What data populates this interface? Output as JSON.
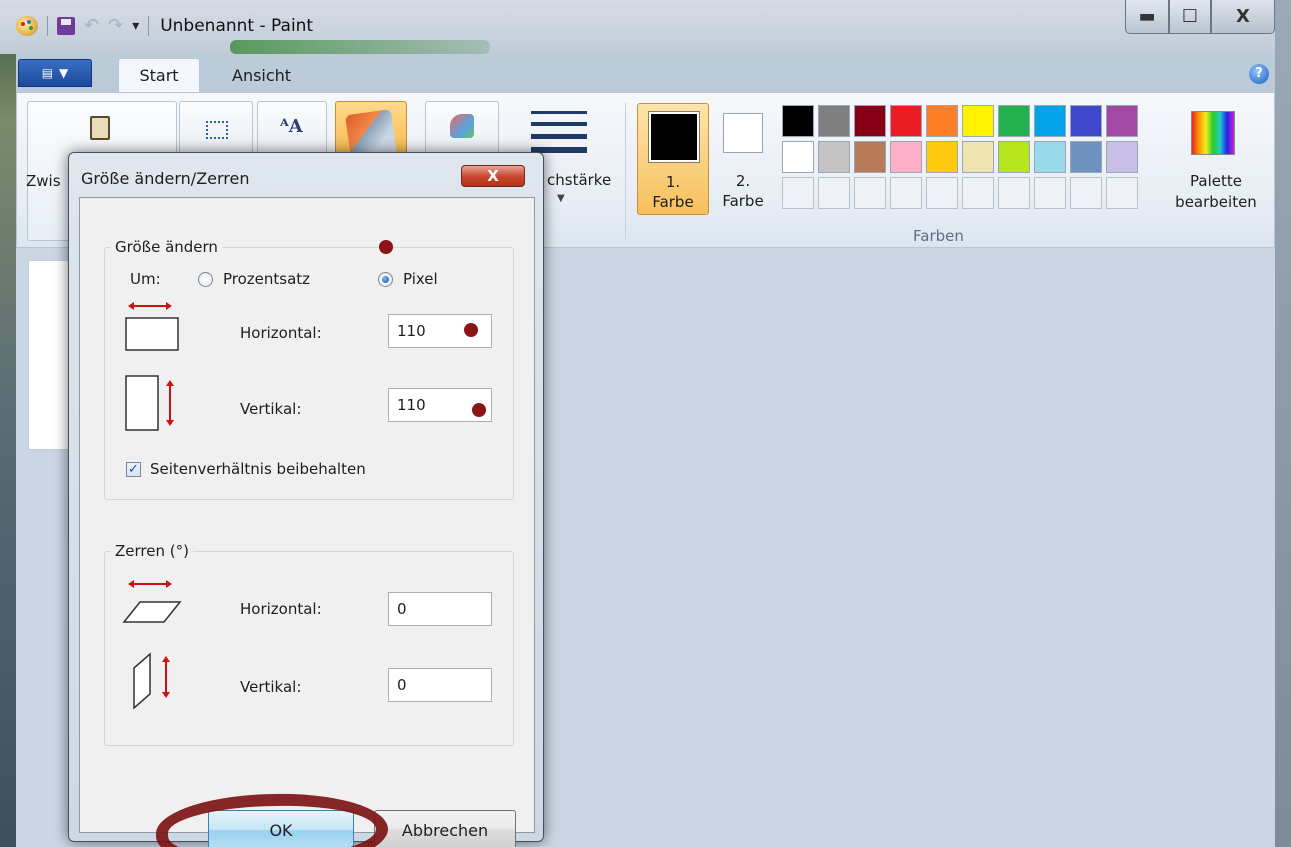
{
  "window": {
    "title": "Unbenannt - Paint",
    "controls": {
      "minimize": "▬",
      "maximize": "☐",
      "close": "X"
    }
  },
  "ribbon": {
    "tabs": [
      {
        "label": "Start"
      },
      {
        "label": "Ansicht"
      }
    ],
    "help": "?",
    "clipboard_label": "Zwis",
    "size_label": "chstärke",
    "color1_label_line1": "1.",
    "color1_label_line2": "Farbe",
    "color2_label_line1": "2.",
    "color2_label_line2": "Farbe",
    "edit_palette_line1": "Palette",
    "edit_palette_line2": "bearbeiten",
    "colors_group": "Farben",
    "palette_row1": [
      "#000000",
      "#7f7f7f",
      "#880015",
      "#ed1c24",
      "#ff7f27",
      "#fff200",
      "#22b14c",
      "#00a2e8",
      "#3f48cc",
      "#a349a4"
    ],
    "palette_row2": [
      "#ffffff",
      "#c3c3c3",
      "#b97a57",
      "#ffaec9",
      "#ffc90e",
      "#efe4b0",
      "#b5e61d",
      "#99d9ea",
      "#7092be",
      "#c8bfe7"
    ]
  },
  "dialog": {
    "title": "Größe ändern/Zerren",
    "close": "X",
    "resize": {
      "legend": "Größe ändern",
      "by_label": "Um:",
      "percent_label": "Prozentsatz",
      "pixel_label": "Pixel",
      "horizontal_label": "Horizontal:",
      "horizontal_value": "110",
      "vertical_label": "Vertikal:",
      "vertical_value": "110",
      "aspect_label": "Seitenverhältnis beibehalten",
      "aspect_check": "✓"
    },
    "skew": {
      "legend": "Zerren (°)",
      "horizontal_label": "Horizontal:",
      "horizontal_value": "0",
      "vertical_label": "Vertikal:",
      "vertical_value": "0"
    },
    "ok_label": "OK",
    "cancel_label": "Abbrechen"
  },
  "icons": {
    "horizontal_resize": "resize-horizontal-icon",
    "vertical_resize": "resize-vertical-icon",
    "horizontal_skew": "skew-horizontal-icon",
    "vertical_skew": "skew-vertical-icon"
  }
}
